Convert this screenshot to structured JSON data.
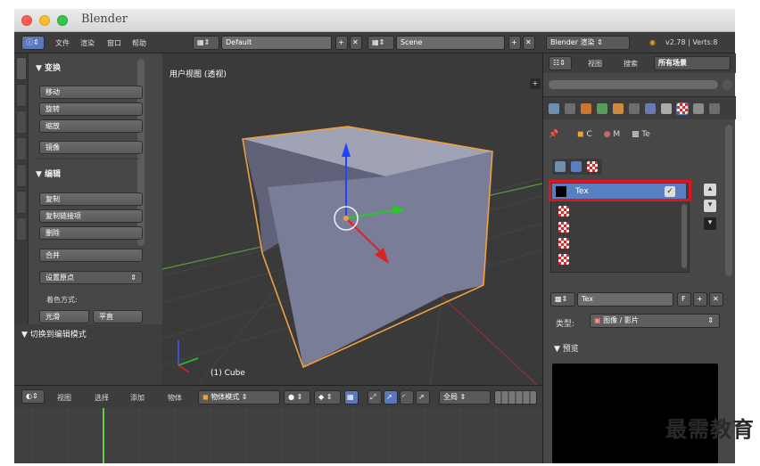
{
  "window": {
    "title": "Blender"
  },
  "info_header": {
    "menus": [
      "文件",
      "渲染",
      "窗口",
      "帮助"
    ],
    "layout": "Default",
    "scene": "Scene",
    "engine": "Blender 渲染",
    "version": "v2.78 | Verts:8"
  },
  "tool_shelf": {
    "transform_title": "▼ 变换",
    "transform_buttons": [
      "移动",
      "旋转",
      "缩放"
    ],
    "mirror_label": "镜像",
    "edit_title": "▼ 编辑",
    "edit_buttons": [
      "复制",
      "复制链接项",
      "删除"
    ],
    "join_label": "合并",
    "origin_label": "设置原点",
    "shading_label": "着色方式:",
    "smooth_label": "光滑",
    "flat_label": "平直",
    "toggle_edit": "▼ 切换到编辑模式"
  },
  "viewport": {
    "view_label": "用户视图 (透视)",
    "object_label": "(1) Cube"
  },
  "bottom_header": {
    "menus": [
      "视图",
      "选择",
      "添加",
      "物体"
    ],
    "mode": "物体模式",
    "orientation": "全局"
  },
  "properties": {
    "header_menus": [
      "视图",
      "搜索"
    ],
    "filter": "所有场景",
    "breadcrumb": [
      "C",
      "M",
      "Te"
    ],
    "texture_slot": "Tex",
    "texture_name": "Tex",
    "fake_user": "F",
    "type_label": "类型:",
    "type_value": "图像 / 影片",
    "preview_label": "▼ 预览"
  },
  "watermark": "最需教育",
  "colors": {
    "highlight": "#e0141e",
    "selected": "#5680c2",
    "cube_face": "#7a7d98",
    "cube_top": "#9a9db2",
    "edge": "#f0a040"
  }
}
